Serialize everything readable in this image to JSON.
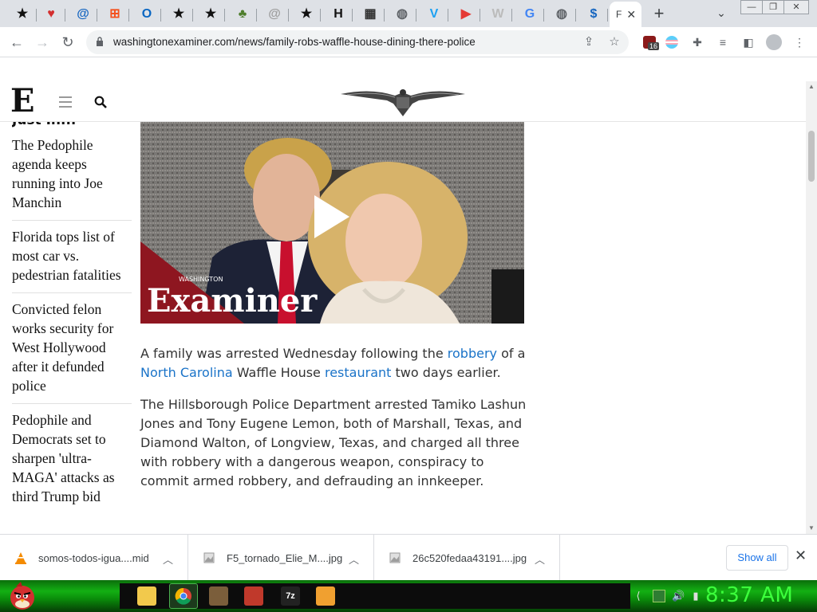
{
  "browser": {
    "tabs": [
      {
        "icon": "star-icon",
        "glyph": "★",
        "color": "#111111"
      },
      {
        "icon": "heart-icon",
        "glyph": "♥",
        "color": "#d32f2f"
      },
      {
        "icon": "at-icon",
        "glyph": "@",
        "color": "#1565c0"
      },
      {
        "icon": "windows-icon",
        "glyph": "⊞",
        "color": "#f4511e"
      },
      {
        "icon": "outlook-icon",
        "glyph": "O",
        "color": "#0a66c2"
      },
      {
        "icon": "star-icon",
        "glyph": "★",
        "color": "#111111"
      },
      {
        "icon": "star-icon",
        "glyph": "★",
        "color": "#111111"
      },
      {
        "icon": "frog-icon",
        "glyph": "♣",
        "color": "#4e7d2c"
      },
      {
        "icon": "at-icon",
        "glyph": "@",
        "color": "#9e9e9e"
      },
      {
        "icon": "star-icon",
        "glyph": "★",
        "color": "#111111"
      },
      {
        "icon": "h-icon",
        "glyph": "H",
        "color": "#111111"
      },
      {
        "icon": "clapper-icon",
        "glyph": "▦",
        "color": "#333333"
      },
      {
        "icon": "globe-icon",
        "glyph": "◍",
        "color": "#5f6368"
      },
      {
        "icon": "v-icon",
        "glyph": "V",
        "color": "#1da1f2"
      },
      {
        "icon": "youtube-icon",
        "glyph": "▶",
        "color": "#e53935"
      },
      {
        "icon": "wiki-icon",
        "glyph": "W",
        "color": "#bbbbbb"
      },
      {
        "icon": "google-icon",
        "glyph": "G",
        "color": "#4285f4"
      },
      {
        "icon": "globe-icon",
        "glyph": "◍",
        "color": "#5f6368"
      },
      {
        "icon": "dollar-icon",
        "glyph": "$",
        "color": "#1565c0"
      }
    ],
    "active_tab_label": "F",
    "active_tab_close": "✕",
    "new_tab": "+",
    "url": "washingtonexaminer.com/news/family-robs-waffle-house-dining-there-police",
    "extension_badge": "16"
  },
  "page": {
    "just_in": "Just In...",
    "sidebar_items": [
      "The Pedophile agenda keeps running into Joe Manchin",
      "Florida tops list of most car vs. pedestrian fatalities",
      "Convicted felon works security for West Hollywood after it defunded police",
      "Pedophile and Democrats set to sharpen 'ultra-MAGA' attacks as third Trump bid"
    ],
    "video_logo_small": "WASHINGTON",
    "video_logo_big": "Examiner",
    "article": {
      "p1_pre": "A family was arrested Wednesday following the ",
      "p1_link1": "robbery",
      "p1_mid": " of a ",
      "p1_link2": "North Carolina",
      "p1_mid2": " Waffle House ",
      "p1_link3": "restaurant",
      "p1_post": " two days earlier.",
      "p2": "The Hillsborough Police Department arrested Tamiko Lashun Jones and Tony Eugene Lemon, both of Marshall, Texas, and Diamond Walton, of Longview, Texas, and charged all three with robbery with a dangerous weapon, conspiracy to commit armed robbery, and defrauding an innkeeper."
    }
  },
  "downloads": {
    "items": [
      {
        "name": "somos-todos-igua....mid",
        "icon": "vlc-cone-icon"
      },
      {
        "name": "F5_tornado_Elie_M....jpg",
        "icon": "image-file-icon"
      },
      {
        "name": "26c520fedaa43191....jpg",
        "icon": "image-file-icon"
      }
    ],
    "show_all": "Show all",
    "close": "✕"
  },
  "taskbar": {
    "clock": "8:37 AM",
    "start_icon": "angry-bird-icon",
    "accent": "#13b013"
  }
}
